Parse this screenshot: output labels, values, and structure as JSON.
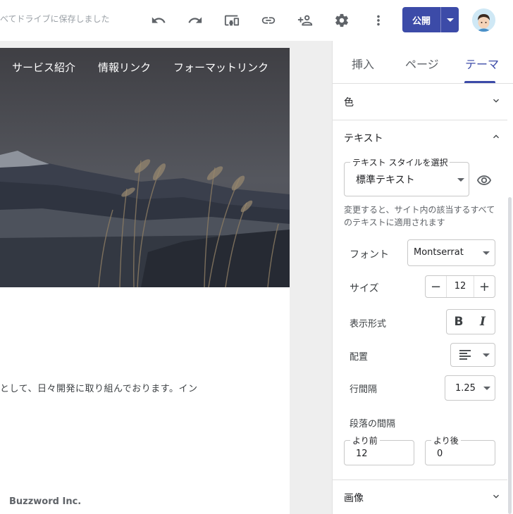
{
  "toolbar": {
    "save_status": "べてドライブに保存しました",
    "publish_label": "公開",
    "icons": [
      "undo-icon",
      "redo-icon",
      "preview-devices-icon",
      "link-icon",
      "share-icon",
      "settings-icon",
      "more-icon"
    ]
  },
  "site": {
    "nav": [
      "サービス紹介",
      "情報リンク",
      "フォーマットリンク"
    ],
    "body_text": "として、日々開発に取り組んでおります。イン",
    "footer": "Buzzword Inc."
  },
  "panel": {
    "tabs": [
      "挿入",
      "ページ",
      "テーマ"
    ],
    "active_tab": "テーマ",
    "sections": {
      "color": "色",
      "text": "テキスト",
      "image": "画像"
    },
    "text_style": {
      "legend": "テキスト スタイルを選択",
      "value": "標準テキスト"
    },
    "help": "変更すると、サイト内の該当するすべてのテキストに適用されます",
    "font": {
      "label": "フォント",
      "value": "Montserrat"
    },
    "size": {
      "label": "サイズ",
      "value": "12",
      "minus": "−",
      "plus": "+"
    },
    "format": {
      "label": "表示形式",
      "bold": "B",
      "italic": "I"
    },
    "align": {
      "label": "配置"
    },
    "line_spacing": {
      "label": "行間隔",
      "value": "1.25"
    },
    "paragraph": {
      "label": "段落の間隔",
      "before_label": "より前",
      "before_value": "12",
      "after_label": "より後",
      "after_value": "0"
    }
  },
  "colors": {
    "accent": "#3c4ba8"
  }
}
